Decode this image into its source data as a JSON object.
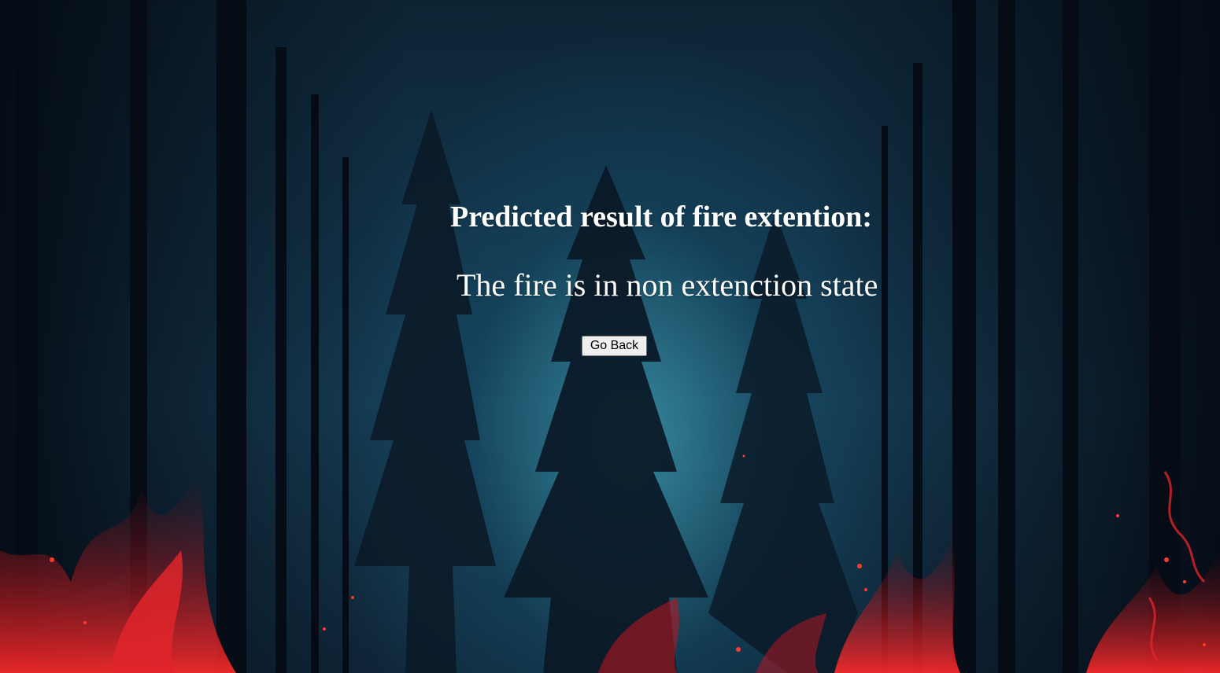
{
  "page": {
    "heading": "Predicted result of fire extention:",
    "result": "The fire is in non extenction state",
    "go_back_label": "Go Back"
  },
  "background": {
    "description_icon": "forest-fire-background",
    "colors": {
      "sky": "#174058",
      "glow": "#3c96aa",
      "trees": "#0a1624",
      "fire": "#d0202a"
    }
  }
}
